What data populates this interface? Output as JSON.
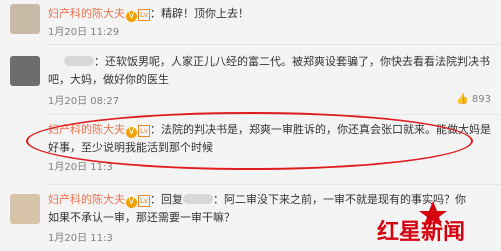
{
  "comments": [
    {
      "user": "妇产科的陈大夫",
      "text": "：精辟！顶你上去！",
      "time": "1月20日 11:29"
    },
    {
      "user": "",
      "text_line1": "：还软饭男呢，人家正儿八经的富二代。被郑爽设套骗了，你快去看看法院判决书",
      "text_line2": "吧，大妈，做好你的医生",
      "time": "1月20日 08:27",
      "likes": "893"
    },
    {
      "user": "妇产科的陈大夫",
      "text_line1": "：法院的判决书是，郑爽一审胜诉的，你还真会张口就来。能做大妈是",
      "text_line2": "好事，至少说明我能活到那个时候",
      "time": "1月20日 11:3"
    },
    {
      "user": "妇产科的陈大夫",
      "text_line1": "：回复",
      "text_line1b": "：阿二审没下来之前，一审不就是现有的事实吗？你",
      "text_line2": "如果不承认一审，那还需要一审干嘛？",
      "time": "1月20日 11:3"
    }
  ],
  "watermark": {
    "line1": "红星新闻",
    "brand": "红星"
  },
  "icons": {
    "verified": "V",
    "level": "Lv",
    "likes": "thumb-up-icon"
  }
}
